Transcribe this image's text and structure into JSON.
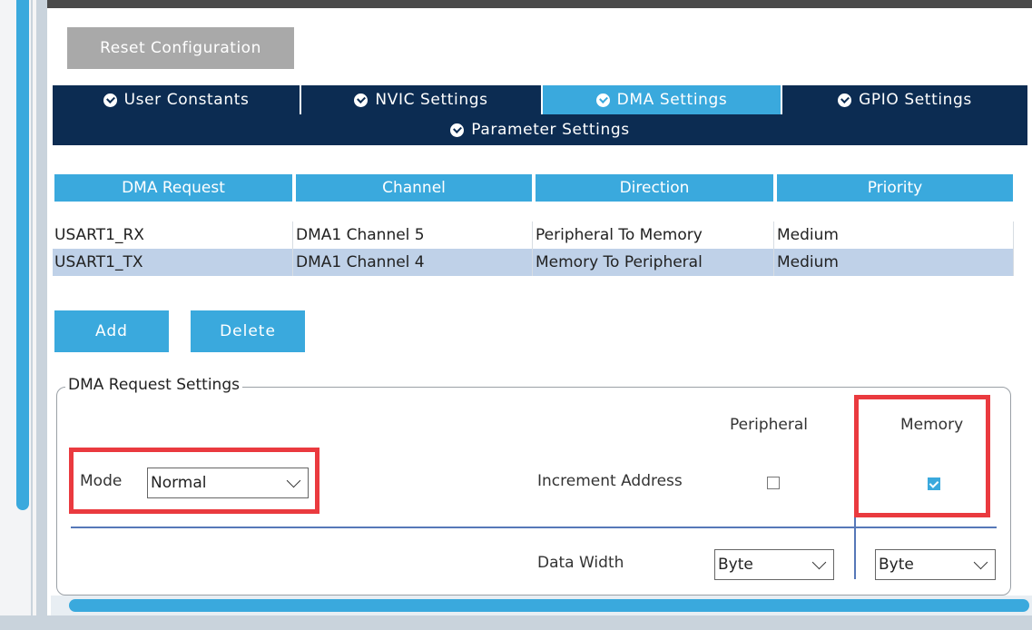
{
  "reset_button": "Reset Configuration",
  "tabs": [
    {
      "label": "User Constants",
      "active": false
    },
    {
      "label": "NVIC Settings",
      "active": false
    },
    {
      "label": "DMA Settings",
      "active": true
    },
    {
      "label": "GPIO Settings",
      "active": false
    },
    {
      "label": "Parameter Settings",
      "active": false
    }
  ],
  "table": {
    "headers": [
      "DMA Request",
      "Channel",
      "Direction",
      "Priority"
    ],
    "rows": [
      [
        "USART1_RX",
        "DMA1 Channel 5",
        "Peripheral To Memory",
        "Medium"
      ],
      [
        "USART1_TX",
        "DMA1 Channel 4",
        "Memory To Peripheral",
        "Medium"
      ]
    ],
    "selected_row": 1
  },
  "buttons": {
    "add": "Add",
    "delete": "Delete"
  },
  "settings": {
    "title": "DMA Request Settings",
    "mode_label": "Mode",
    "mode_value": "Normal",
    "col_peripheral": "Peripheral",
    "col_memory": "Memory",
    "increment_label": "Increment Address",
    "increment_peripheral": false,
    "increment_memory": true,
    "data_width_label": "Data Width",
    "data_width_peripheral": "Byte",
    "data_width_memory": "Byte"
  },
  "colors": {
    "accent": "#3aa9dd",
    "tab_dark": "#0c2c52",
    "highlight": "#ea3a3f",
    "selected_row": "#bfd1e8"
  }
}
